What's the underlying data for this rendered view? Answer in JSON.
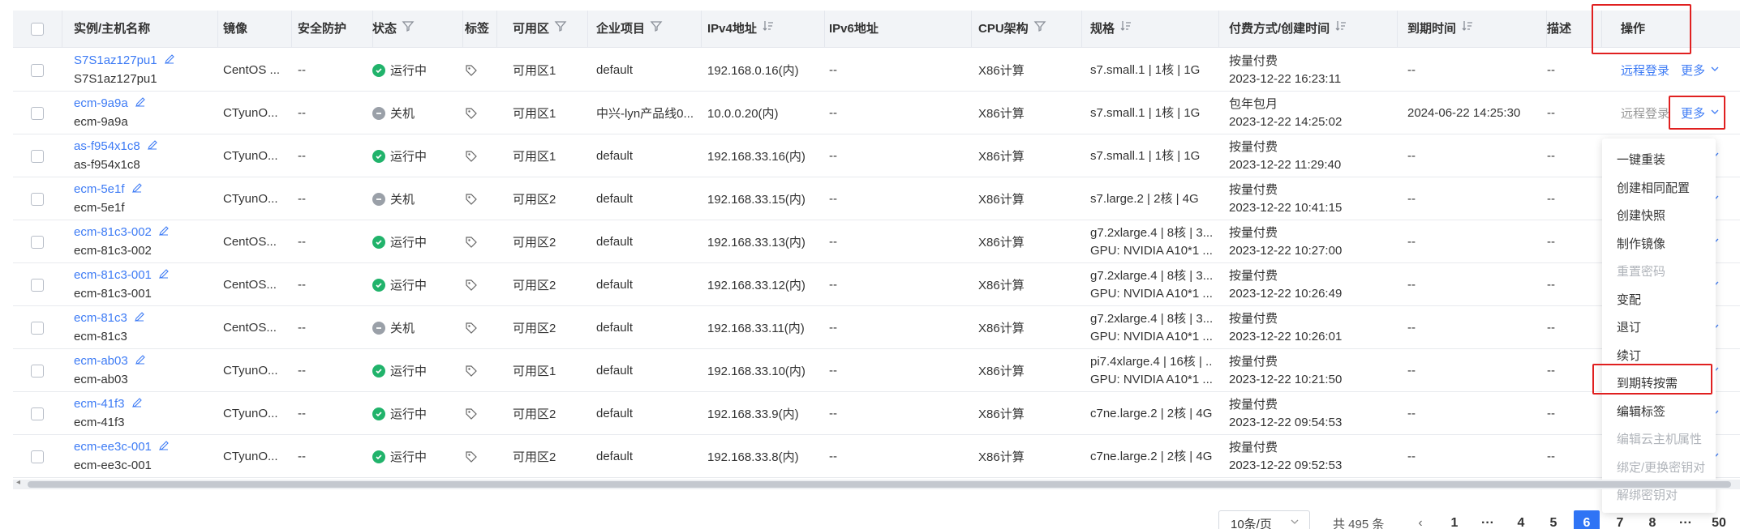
{
  "columns": {
    "name": "实例/主机名称",
    "image": "镜像",
    "security": "安全防护",
    "status": "状态",
    "tags": "标签",
    "zone": "可用区",
    "project": "企业项目",
    "ipv4": "IPv4地址",
    "ipv6": "IPv6地址",
    "cpu": "CPU架构",
    "spec": "规格",
    "billing": "付费方式/创建时间",
    "expire": "到期时间",
    "desc": "描述",
    "ops": "操作"
  },
  "rows": [
    {
      "name": "S7S1az127pu1",
      "host": "S7S1az127pu1",
      "image": "CentOS ...",
      "security": "--",
      "status": "运行中",
      "status_type": "run",
      "zone": "可用区1",
      "project": "default",
      "ipv4": "192.168.0.16(内)",
      "ipv6": "--",
      "cpu": "X86计算",
      "spec1": "s7.small.1 | 1核 | 1G",
      "spec2": "",
      "bill": "按量付费",
      "created": "2023-12-22 16:23:11",
      "expire": "--",
      "desc": "--"
    },
    {
      "name": "ecm-9a9a",
      "host": "ecm-9a9a",
      "image": "CTyunO...",
      "security": "--",
      "status": "关机",
      "status_type": "off",
      "zone": "可用区1",
      "project": "中兴-lyn产品线0...",
      "ipv4": "10.0.0.20(内)",
      "ipv6": "--",
      "cpu": "X86计算",
      "spec1": "s7.small.1 | 1核 | 1G",
      "spec2": "",
      "bill": "包年包月",
      "created": "2023-12-22 14:25:02",
      "expire": "2024-06-22 14:25:30",
      "desc": "--"
    },
    {
      "name": "as-f954x1c8",
      "host": "as-f954x1c8",
      "image": "CTyunO...",
      "security": "--",
      "status": "运行中",
      "status_type": "run",
      "zone": "可用区1",
      "project": "default",
      "ipv4": "192.168.33.16(内)",
      "ipv6": "--",
      "cpu": "X86计算",
      "spec1": "s7.small.1 | 1核 | 1G",
      "spec2": "",
      "bill": "按量付费",
      "created": "2023-12-22 11:29:40",
      "expire": "--",
      "desc": "--"
    },
    {
      "name": "ecm-5e1f",
      "host": "ecm-5e1f",
      "image": "CTyunO...",
      "security": "--",
      "status": "关机",
      "status_type": "off",
      "zone": "可用区2",
      "project": "default",
      "ipv4": "192.168.33.15(内)",
      "ipv6": "--",
      "cpu": "X86计算",
      "spec1": "s7.large.2 | 2核 | 4G",
      "spec2": "",
      "bill": "按量付费",
      "created": "2023-12-22 10:41:15",
      "expire": "--",
      "desc": "--"
    },
    {
      "name": "ecm-81c3-002",
      "host": "ecm-81c3-002",
      "image": "CentOS...",
      "security": "--",
      "status": "运行中",
      "status_type": "run",
      "zone": "可用区2",
      "project": "default",
      "ipv4": "192.168.33.13(内)",
      "ipv6": "--",
      "cpu": "X86计算",
      "spec1": "g7.2xlarge.4 | 8核 | 3...",
      "spec2": "GPU: NVIDIA A10*1 ...",
      "bill": "按量付费",
      "created": "2023-12-22 10:27:00",
      "expire": "--",
      "desc": "--"
    },
    {
      "name": "ecm-81c3-001",
      "host": "ecm-81c3-001",
      "image": "CentOS...",
      "security": "--",
      "status": "运行中",
      "status_type": "run",
      "zone": "可用区2",
      "project": "default",
      "ipv4": "192.168.33.12(内)",
      "ipv6": "--",
      "cpu": "X86计算",
      "spec1": "g7.2xlarge.4 | 8核 | 3...",
      "spec2": "GPU: NVIDIA A10*1 ...",
      "bill": "按量付费",
      "created": "2023-12-22 10:26:49",
      "expire": "--",
      "desc": "--"
    },
    {
      "name": "ecm-81c3",
      "host": "ecm-81c3",
      "image": "CentOS...",
      "security": "--",
      "status": "关机",
      "status_type": "off",
      "zone": "可用区2",
      "project": "default",
      "ipv4": "192.168.33.11(内)",
      "ipv6": "--",
      "cpu": "X86计算",
      "spec1": "g7.2xlarge.4 | 8核 | 3...",
      "spec2": "GPU: NVIDIA A10*1 ...",
      "bill": "按量付费",
      "created": "2023-12-22 10:26:01",
      "expire": "--",
      "desc": "--"
    },
    {
      "name": "ecm-ab03",
      "host": "ecm-ab03",
      "image": "CTyunO...",
      "security": "--",
      "status": "运行中",
      "status_type": "run",
      "zone": "可用区1",
      "project": "default",
      "ipv4": "192.168.33.10(内)",
      "ipv6": "--",
      "cpu": "X86计算",
      "spec1": "pi7.4xlarge.4 | 16核 | ...",
      "spec2": "GPU: NVIDIA A10*1 ...",
      "bill": "按量付费",
      "created": "2023-12-22 10:21:50",
      "expire": "--",
      "desc": "--"
    },
    {
      "name": "ecm-41f3",
      "host": "ecm-41f3",
      "image": "CTyunO...",
      "security": "--",
      "status": "运行中",
      "status_type": "run",
      "zone": "可用区2",
      "project": "default",
      "ipv4": "192.168.33.9(内)",
      "ipv6": "--",
      "cpu": "X86计算",
      "spec1": "c7ne.large.2 | 2核 | 4G",
      "spec2": "",
      "bill": "按量付费",
      "created": "2023-12-22 09:54:53",
      "expire": "--",
      "desc": "--"
    },
    {
      "name": "ecm-ee3c-001",
      "host": "ecm-ee3c-001",
      "image": "CTyunO...",
      "security": "--",
      "status": "运行中",
      "status_type": "run",
      "zone": "可用区2",
      "project": "default",
      "ipv4": "192.168.33.8(内)",
      "ipv6": "--",
      "cpu": "X86计算",
      "spec1": "c7ne.large.2 | 2核 | 4G",
      "spec2": "",
      "bill": "按量付费",
      "created": "2023-12-22 09:52:53",
      "expire": "--",
      "desc": "--"
    }
  ],
  "row_actions": {
    "remote_login": "远程登录",
    "more": "更多"
  },
  "more_menu": [
    {
      "label": "一键重装",
      "disabled": false
    },
    {
      "label": "创建相同配置",
      "disabled": false
    },
    {
      "label": "创建快照",
      "disabled": false
    },
    {
      "label": "制作镜像",
      "disabled": false
    },
    {
      "label": "重置密码",
      "disabled": true
    },
    {
      "label": "变配",
      "disabled": false
    },
    {
      "label": "退订",
      "disabled": false
    },
    {
      "label": "续订",
      "disabled": false
    },
    {
      "label": "到期转按需",
      "disabled": false,
      "highlighted": true
    },
    {
      "label": "编辑标签",
      "disabled": false
    },
    {
      "label": "编辑云主机属性",
      "disabled": true
    },
    {
      "label": "绑定/更换密钥对",
      "disabled": true
    },
    {
      "label": "解绑密钥对",
      "disabled": true
    }
  ],
  "pagination": {
    "page_size": "10条/页",
    "total": "共 495 条",
    "pages": [
      "1",
      "···",
      "4",
      "5",
      "6",
      "7",
      "8",
      "···",
      "50"
    ],
    "current": "6"
  },
  "colors": {
    "link": "#3d7bf5",
    "running": "#21b36b",
    "stopped": "#9aa0a8",
    "highlight_box": "#e02020",
    "active_page": "#2f74f5"
  }
}
